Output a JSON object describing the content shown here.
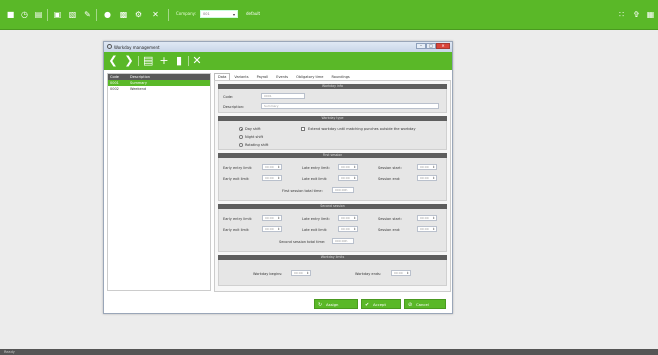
{
  "topbar": {
    "icons": [
      "save-icon",
      "history-icon",
      "document-icon",
      "image-icon",
      "export-icon",
      "edit-document-icon",
      "search-user-icon",
      "chart-icon",
      "settings-icon",
      "close-icon"
    ],
    "company_label": "Company:",
    "company_select_value": "001",
    "company_name": "default",
    "right_icons": [
      "grid-icon",
      "user-icon",
      "calendar-icon"
    ]
  },
  "window": {
    "title": "Workday management",
    "controls": {
      "minimize": "–",
      "maximize": "□",
      "close": "✕"
    },
    "toolbar_icons": [
      "back-icon",
      "forward-icon",
      "save-icon",
      "add-icon",
      "delete-icon",
      "close-icon"
    ]
  },
  "list": {
    "columns": [
      "Code",
      "Description"
    ],
    "rows": [
      {
        "code": "0001",
        "description": "Summary"
      },
      {
        "code": "0002",
        "description": "Weekend"
      }
    ]
  },
  "tabs": [
    "Data",
    "Variants",
    "Payroll",
    "Events",
    "Obligatory time",
    "Roundings"
  ],
  "workday_info": {
    "header": "Workday info",
    "code_label": "Code:",
    "code_value": "0001",
    "description_label": "Description:",
    "description_value": "Summary"
  },
  "workday_type": {
    "header": "Workday type",
    "options": [
      "Day shift",
      "Night shift",
      "Rotating shift"
    ],
    "selected": "Day shift",
    "extend_label": "Extend workday until matching punches outside the workday"
  },
  "first_session": {
    "header": "First session",
    "early_entry_label": "Early entry limit:",
    "early_entry_value": "00:00",
    "late_entry_label": "Late entry limit:",
    "late_entry_value": "00:00",
    "session_start_label": "Session start:",
    "session_start_value": "00:00",
    "early_exit_label": "Early exit limit:",
    "early_exit_value": "00:00",
    "late_exit_label": "Late exit limit:",
    "late_exit_value": "00:00",
    "session_end_label": "Session end:",
    "session_end_value": "00:00",
    "total_label": "First session total time:",
    "total_value": "000:00h"
  },
  "second_session": {
    "header": "Second session",
    "early_entry_label": "Early entry limit:",
    "early_entry_value": "00:00",
    "late_entry_label": "Late entry limit:",
    "late_entry_value": "00:00",
    "session_start_label": "Session start:",
    "session_start_value": "00:00",
    "early_exit_label": "Early exit limit:",
    "early_exit_value": "00:00",
    "late_exit_label": "Late exit limit:",
    "late_exit_value": "00:00",
    "session_end_label": "Session end:",
    "session_end_value": "00:00",
    "total_label": "Second session total time:",
    "total_value": "000:00h"
  },
  "workday_limits": {
    "header": "Workday limits",
    "begins_label": "Workday begins:",
    "begins_value": "00:00",
    "ends_label": "Workday ends:",
    "ends_value": "00:00"
  },
  "footer": {
    "assign_label": "Assign",
    "accept_label": "Accept",
    "cancel_label": "Cancel"
  },
  "statusbar": {
    "text": "Ready"
  },
  "colors": {
    "accent": "#5ab828",
    "section_header": "#5e5e5e",
    "close": "#d9453b"
  }
}
